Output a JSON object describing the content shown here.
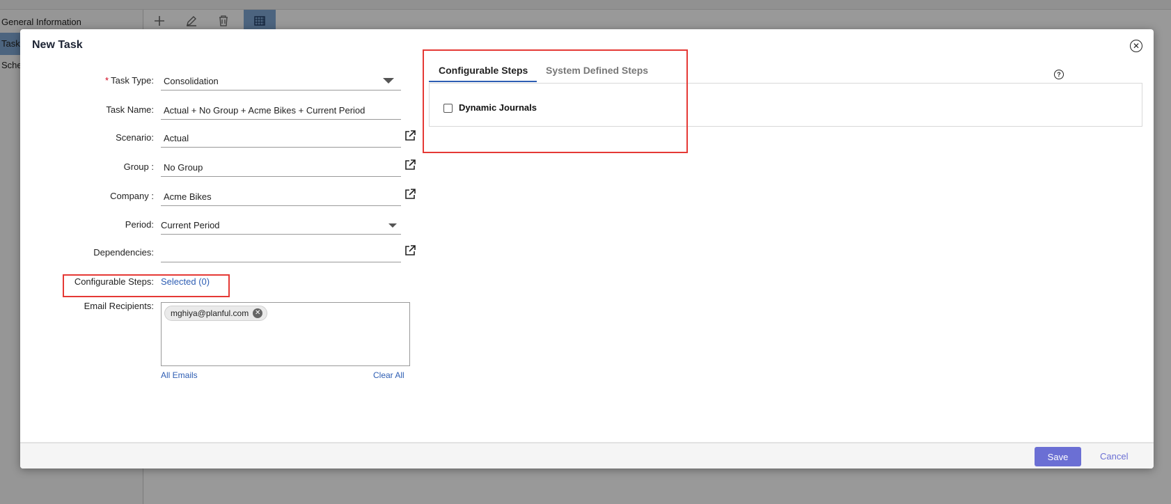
{
  "background": {
    "sidebar_items": [
      "General Information",
      "Task",
      "Sche"
    ],
    "toolbar": {
      "add_icon": "plus-icon",
      "edit_icon": "pencil-icon",
      "delete_icon": "trash-icon",
      "calendar_icon": "calendar-grid-icon"
    }
  },
  "modal": {
    "title": "New Task",
    "close_icon": "close-circle-icon",
    "form": {
      "task_type": {
        "label": "Task Type:",
        "required_mark": "*",
        "value": "Consolidation"
      },
      "task_name": {
        "label": "Task Name:",
        "value": "Actual + No Group + Acme Bikes + Current Period"
      },
      "scenario": {
        "label": "Scenario:",
        "value": "Actual"
      },
      "group": {
        "label": "Group :",
        "value": "No Group"
      },
      "company": {
        "label": "Company :",
        "value": "Acme Bikes"
      },
      "period": {
        "label": "Period:",
        "value": "Current Period"
      },
      "dependencies": {
        "label": "Dependencies:",
        "value": ""
      },
      "configurable_steps": {
        "label": "Configurable Steps:",
        "value": "Selected (0)"
      },
      "email_recipients": {
        "label": "Email Recipients:",
        "chips": [
          "mghiya@planful.com"
        ],
        "all_emails": "All Emails",
        "clear_all": "Clear All"
      }
    },
    "tabs": [
      {
        "label": "Configurable Steps",
        "active": true
      },
      {
        "label": "System Defined Steps",
        "active": false
      }
    ],
    "help_icon": "question-circle-icon",
    "steps": [
      {
        "label": "Dynamic Journals",
        "checked": false
      }
    ],
    "footer": {
      "save_label": "Save",
      "cancel_label": "Cancel"
    }
  },
  "colors": {
    "accent": "#6b6fd4",
    "link": "#2d5db3",
    "highlight": "#e53935",
    "required": "#d0021b"
  }
}
